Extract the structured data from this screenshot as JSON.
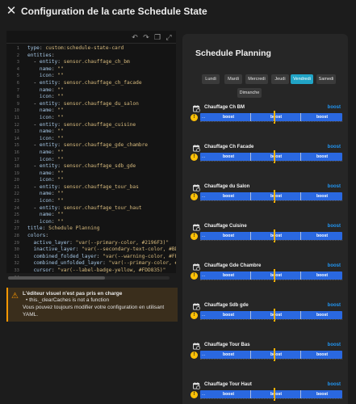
{
  "header": {
    "title": "Configuration de la carte Schedule State",
    "close_icon": "close-icon"
  },
  "editor": {
    "toolbar_icons": [
      "undo-icon",
      "redo-icon",
      "copy-icon",
      "fullscreen-icon"
    ],
    "line_numbers": [
      "1",
      "2",
      "3",
      "4",
      "5",
      "6",
      "7",
      "8",
      "9",
      "10",
      "11",
      "12",
      "13",
      "14",
      "15",
      "16",
      "17",
      "18",
      "19",
      "20",
      "21",
      "22",
      "23",
      "24",
      "25",
      "26",
      "27",
      "28",
      "29",
      "30",
      "31",
      "32",
      "33",
      "34"
    ],
    "lines": [
      "type: custom:schedule-state-card",
      "entities:",
      "  - entity: sensor.chauffage_ch_bm",
      "    name: \"\"",
      "    icon: \"\"",
      "  - entity: sensor.chauffage_ch_facade",
      "    name: \"\"",
      "    icon: \"\"",
      "  - entity: sensor.chauffage_du_salon",
      "    name: \"\"",
      "    icon: \"\"",
      "  - entity: sensor.chauffage_cuisine",
      "    name: \"\"",
      "    icon: \"\"",
      "  - entity: sensor.chauffage_gde_chambre",
      "    name: \"\"",
      "    icon: \"\"",
      "  - entity: sensor.chauffage_sdb_gde",
      "    name: \"\"",
      "    icon: \"\"",
      "  - entity: sensor.chauffage_tour_bas",
      "    name: \"\"",
      "    icon: \"\"",
      "  - entity: sensor.chauffage_tour_haut",
      "    name: \"\"",
      "    icon: \"\"",
      "title: Schedule Planning",
      "colors:",
      "  active_layer: \"var(--primary-color, #2196F3)\"",
      "  inactive_layer: \"var(--secondary-text-color, #BDBDBD)\"",
      "  combined_folded_layer: \"var(--warning-color, #FF9800)\"",
      "  combined_unfolded_layer: \"var(--primary-color, #2196F3)\"",
      "  cursor: \"var(--label-badge-yellow, #FDD835)\"",
      ""
    ]
  },
  "warning": {
    "title": "L'éditeur visuel n'est pas pris en charge",
    "detail": "• this._clearCaches is not a function",
    "message": "Vous pouvez toujours modifier votre configuration en utilisant YAML.",
    "icon": "warning-icon"
  },
  "card": {
    "title": "Schedule Planning",
    "days": [
      "Lundi",
      "Mardi",
      "Mercredi",
      "Jeudi",
      "Vendredi",
      "Samedi",
      "Dimanche"
    ],
    "selected_day": "Vendredi",
    "accent_color": "#21a4c6",
    "bar_color": "#2a68e0",
    "cursor_color": "#ffb300",
    "sensors": [
      {
        "name": "Chauffage Ch BM",
        "state": "boost",
        "segments": [
          "boost",
          "boost",
          "boost"
        ]
      },
      {
        "name": "Chauffage Ch Facade",
        "state": "boost",
        "segments": [
          "boost",
          "boost",
          "boost"
        ]
      },
      {
        "name": "Chauffage du Salon",
        "state": "boost",
        "segments": [
          "boost",
          "boost",
          "boost"
        ]
      },
      {
        "name": "Chauffage Cuisine",
        "state": "boost",
        "segments": [
          "boost",
          "boost",
          "boost"
        ]
      },
      {
        "name": "Chauffage Gde Chambre",
        "state": "boost",
        "segments": [
          "boost",
          "boost",
          "boost"
        ]
      },
      {
        "name": "Chauffage Sdb gde",
        "state": "boost",
        "segments": [
          "boost",
          "boost",
          "boost"
        ]
      },
      {
        "name": "Chauffage Tour Bas",
        "state": "boost",
        "segments": [
          "boost",
          "boost",
          "boost"
        ]
      },
      {
        "name": "Chauffage Tour Haut",
        "state": "boost",
        "segments": [
          "boost",
          "boost",
          "boost"
        ]
      }
    ],
    "sensor_icon": "calendar-clock-icon",
    "alert_icon": "alert-icon"
  }
}
